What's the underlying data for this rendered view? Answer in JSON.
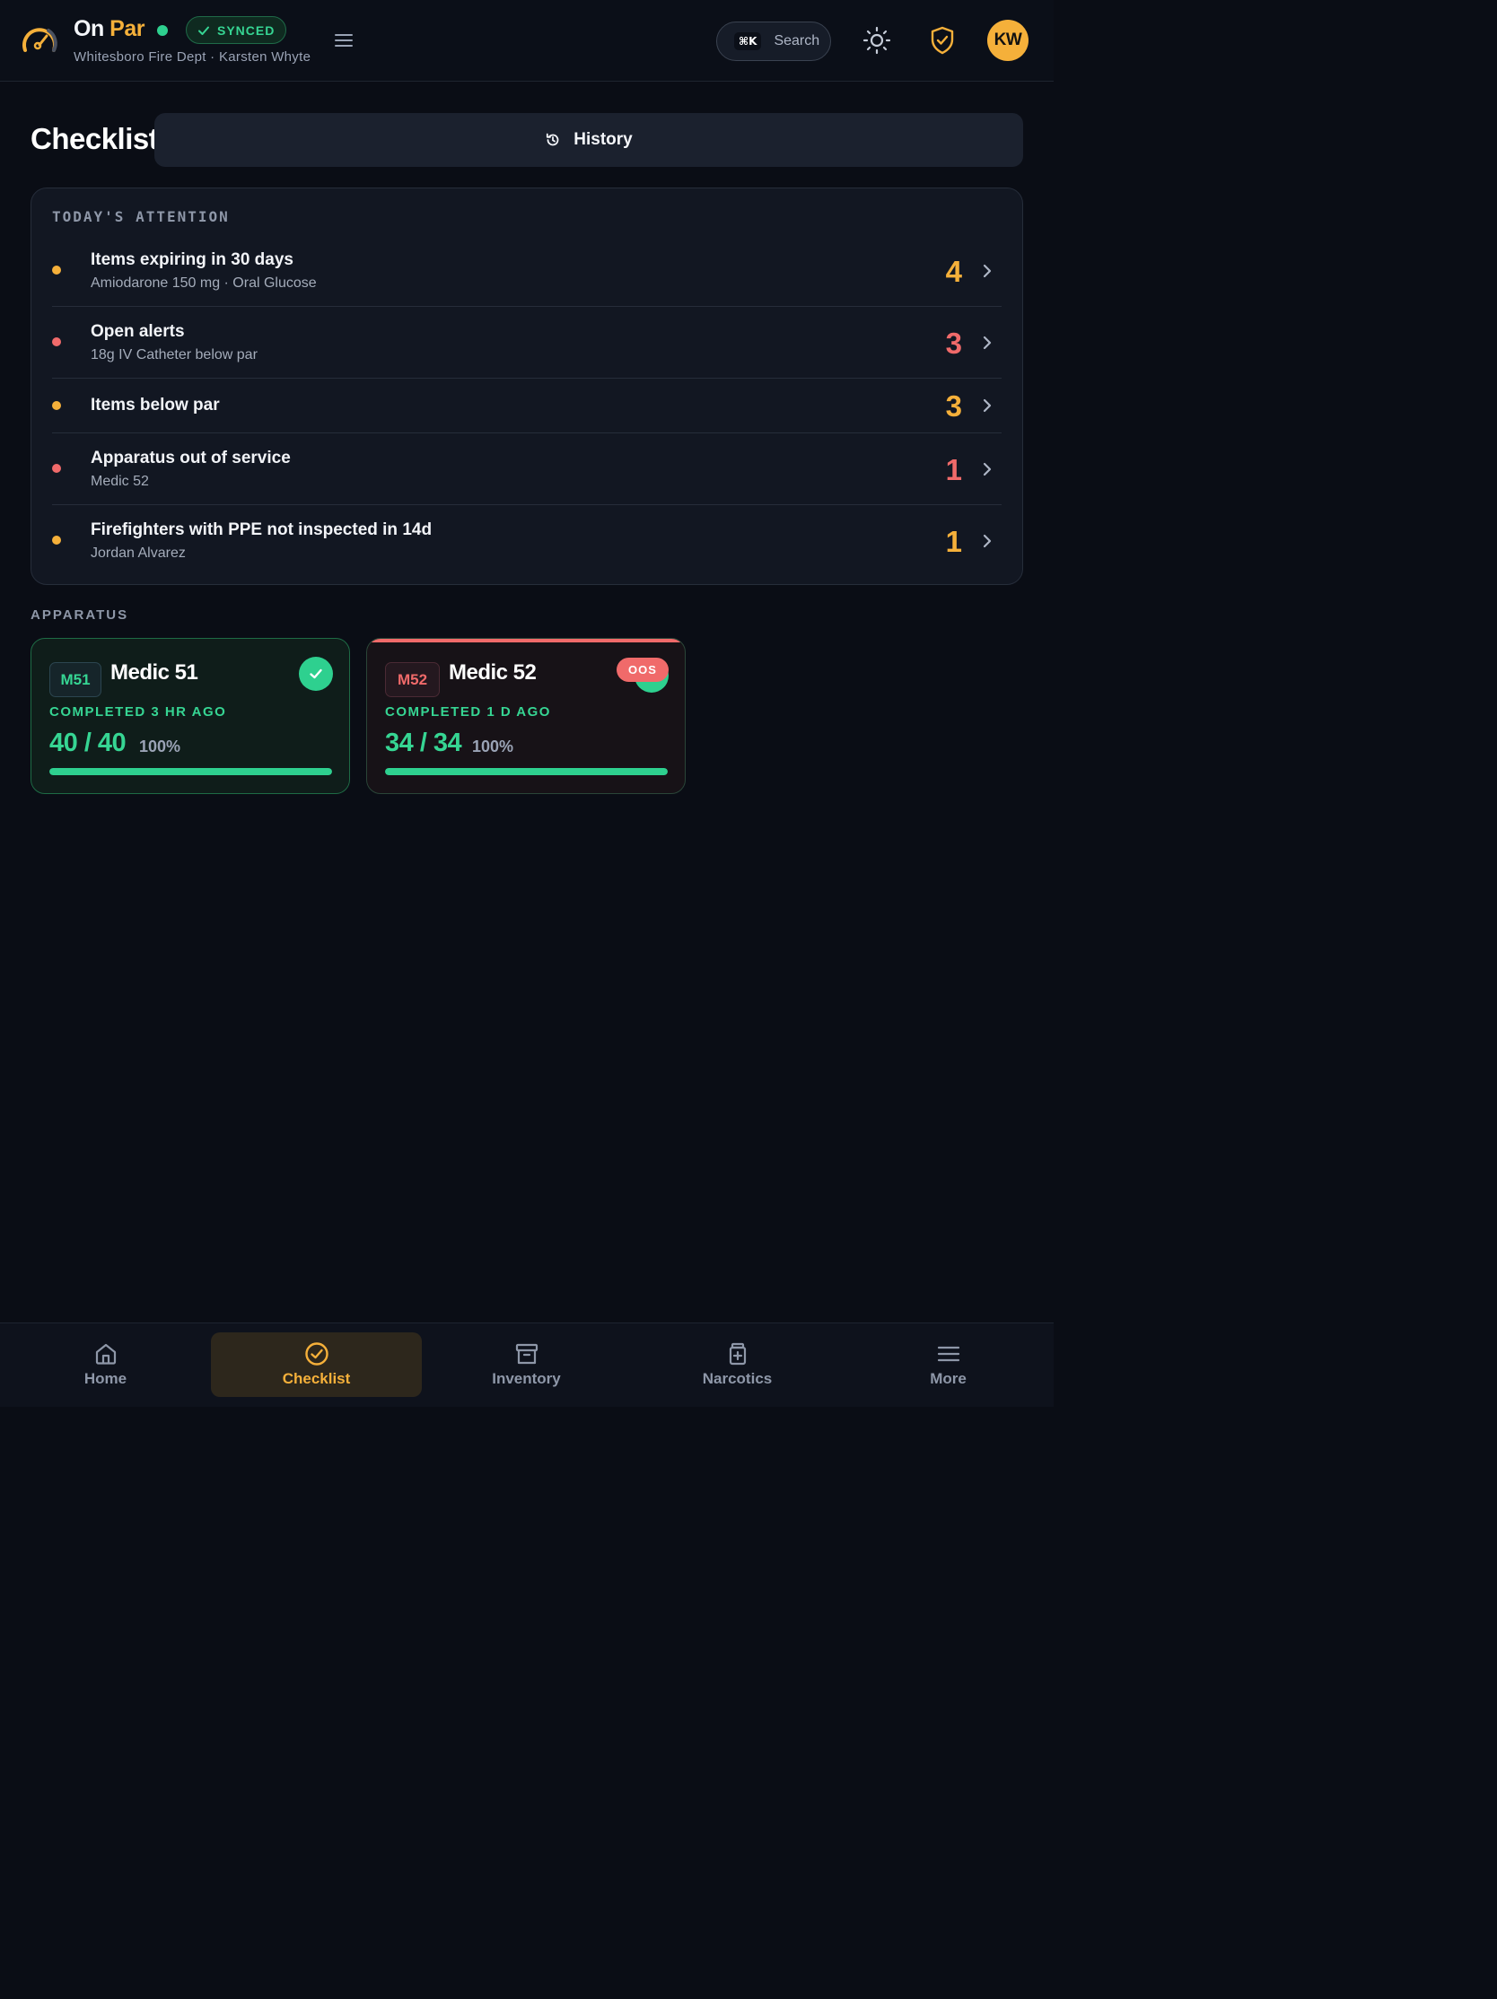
{
  "header": {
    "brand_part1": "On",
    "brand_part2": "Par",
    "sync_status": "SYNCED",
    "subtitle": "Whitesboro Fire Dept · Karsten Whyte",
    "search_shortcut": "⌘K",
    "search_label": "Search",
    "avatar_initials": "KW"
  },
  "page": {
    "title": "Checklist",
    "history_label": "History"
  },
  "attention": {
    "heading": "TODAY'S ATTENTION",
    "items": [
      {
        "title": "Items expiring in 30 days",
        "subtitle": "Amiodarone 150 mg · Oral Glucose",
        "count": "4",
        "color": "#f5b03a"
      },
      {
        "title": "Open alerts",
        "subtitle": "18g IV Catheter below par",
        "count": "3",
        "color": "#f06a6a"
      },
      {
        "title": "Items below par",
        "subtitle": "",
        "count": "3",
        "color": "#f5b03a"
      },
      {
        "title": "Apparatus out of service",
        "subtitle": "Medic 52",
        "count": "1",
        "color": "#f06a6a"
      },
      {
        "title": "Firefighters with PPE not inspected in 14d",
        "subtitle": "Jordan Alvarez",
        "count": "1",
        "color": "#f5b03a"
      }
    ]
  },
  "apparatus": {
    "heading": "APPARATUS",
    "cards": [
      {
        "code": "M51",
        "name": "Medic 51",
        "status": "COMPLETED 3 HR AGO",
        "count": "40 / 40",
        "percent": "100%",
        "progress": 1.0,
        "badge": ""
      },
      {
        "code": "M52",
        "name": "Medic 52",
        "status": "COMPLETED 1 D AGO",
        "count": "34 / 34",
        "percent": "100%",
        "progress": 1.0,
        "badge": "OOS"
      }
    ]
  },
  "nav": {
    "items": [
      {
        "label": "Home",
        "icon": "home-icon"
      },
      {
        "label": "Checklist",
        "icon": "checklist-icon"
      },
      {
        "label": "Inventory",
        "icon": "archive-icon"
      },
      {
        "label": "Narcotics",
        "icon": "medicine-icon"
      },
      {
        "label": "More",
        "icon": "menu-icon"
      }
    ],
    "active": "Checklist"
  },
  "colors": {
    "accent": "#f5b03a",
    "success": "#2ed08f",
    "danger": "#f06a6a",
    "background": "#0a0d15"
  }
}
